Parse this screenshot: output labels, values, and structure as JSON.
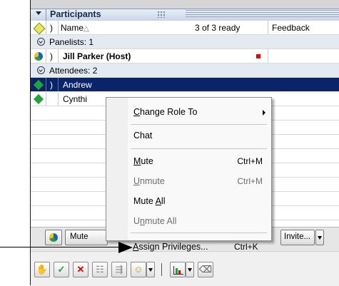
{
  "panel": {
    "title": "Participants",
    "header": {
      "name_col": "Name",
      "sort_glyph": "△",
      "status": "3 of 3 ready",
      "feedback_col": "Feedback"
    },
    "groups": [
      {
        "label": "Panelists: 1"
      },
      {
        "label": "Attendees: 2"
      }
    ],
    "rows": [
      {
        "name": "Jill Parker (Host)",
        "icon": "globe-icon"
      },
      {
        "name": "Andrew",
        "icon": "green-diamond-icon",
        "selected": true
      },
      {
        "name": "Cynthi",
        "icon": "green-diamond-icon"
      }
    ],
    "toolbar": {
      "mute_label": "Mute",
      "invite_label": "Invite..."
    }
  },
  "context_menu": {
    "items": [
      {
        "pre": "",
        "u": "C",
        "post": "hange Role To",
        "shortcut": "",
        "submenu": true,
        "disabled": false
      },
      {
        "pre": "",
        "u": "",
        "post": "Chat",
        "shortcut": "",
        "disabled": false
      },
      {
        "pre": "",
        "u": "M",
        "post": "ute",
        "shortcut": "Ctrl+M",
        "disabled": false
      },
      {
        "pre": "",
        "u": "U",
        "post": "nmute",
        "shortcut": "Ctrl+M",
        "disabled": true
      },
      {
        "pre": "Mute ",
        "u": "A",
        "post": "ll",
        "shortcut": "",
        "disabled": false
      },
      {
        "pre": "U",
        "u": "n",
        "post": "mute All",
        "shortcut": "",
        "disabled": true
      },
      {
        "pre": "",
        "u": "A",
        "post": "ssign Privileges...",
        "shortcut": "Ctrl+K",
        "disabled": false
      }
    ]
  },
  "colors": {
    "selection": "#0a246a",
    "accent_green": "#1fa43a",
    "red": "#e00000"
  }
}
